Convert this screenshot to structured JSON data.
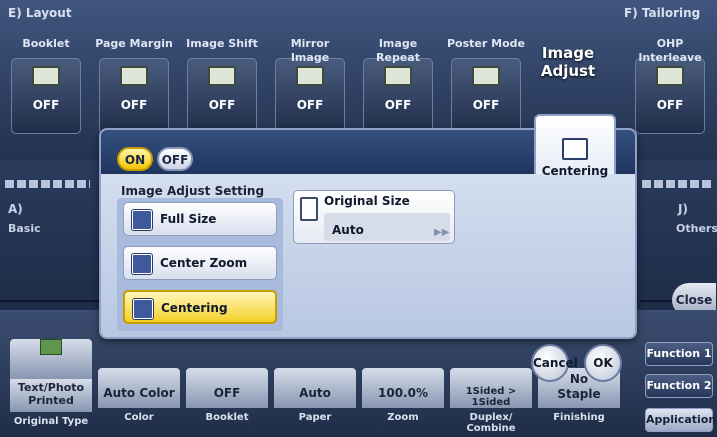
{
  "sections": {
    "layout": "E) Layout",
    "tailoring": "F) Tailoring",
    "basic_letter": "A)",
    "basic": "Basic",
    "others_letter": "J)",
    "others": "Others"
  },
  "top_row": [
    {
      "label": "Booklet",
      "value": "OFF"
    },
    {
      "label": "Page Margin",
      "value": "OFF"
    },
    {
      "label": "Image Shift",
      "value": "OFF"
    },
    {
      "label": "Mirror Image",
      "value": "OFF"
    },
    {
      "label": "Image Repeat",
      "value": "OFF"
    },
    {
      "label": "Poster Mode",
      "value": "OFF"
    },
    {
      "label": "Image Adjust",
      "value": "Centering"
    },
    {
      "label": "OHP Interleave",
      "value": "OFF"
    }
  ],
  "dialog": {
    "title": "Image Adjust",
    "on_label": "ON",
    "off_label": "OFF",
    "setting_label": "Image Adjust Setting",
    "options": [
      "Full Size",
      "Center Zoom",
      "Centering"
    ],
    "selected_option": "Centering",
    "original_size_label": "Original Size",
    "original_size_value": "Auto",
    "cancel_label": "Cancel",
    "ok_label": "OK"
  },
  "bottom_row": [
    {
      "value": "Text/Photo Printed",
      "label": "Original Type"
    },
    {
      "value": "Auto Color",
      "label": "Color"
    },
    {
      "value": "OFF",
      "label": "Booklet"
    },
    {
      "value": "Auto",
      "label": "Paper"
    },
    {
      "value": "100.0%",
      "label": "Zoom"
    },
    {
      "value": "1Sided > 1Sided",
      "label": "Duplex/ Combine"
    },
    {
      "value": "Staple",
      "label": "Finishing"
    }
  ],
  "right_buttons": {
    "close": "Close",
    "function1": "Function 1",
    "function2": "Function 2",
    "application": "Application"
  },
  "staple_prefix": "No"
}
